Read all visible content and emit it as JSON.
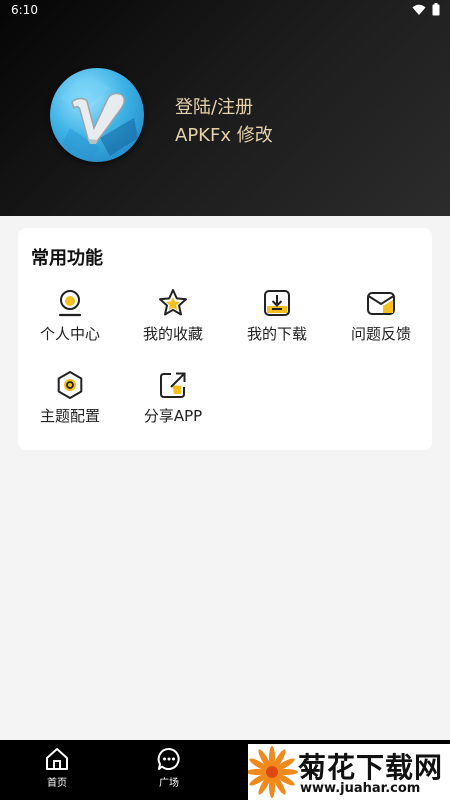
{
  "status_bar": {
    "time": "6:10"
  },
  "profile": {
    "login_label": "登陆/注册",
    "subtitle": "APKFx 修改",
    "avatar_letter": "V"
  },
  "features": {
    "title": "常用功能",
    "items": [
      {
        "label": "个人中心",
        "icon": "user-icon"
      },
      {
        "label": "我的收藏",
        "icon": "star-icon"
      },
      {
        "label": "我的下载",
        "icon": "download-icon"
      },
      {
        "label": "问题反馈",
        "icon": "mail-icon"
      },
      {
        "label": "主题配置",
        "icon": "theme-icon"
      },
      {
        "label": "分享APP",
        "icon": "share-icon"
      }
    ]
  },
  "bottom_nav": {
    "items": [
      {
        "label": "首页",
        "icon": "home-icon"
      },
      {
        "label": "广场",
        "icon": "chat-icon"
      }
    ]
  },
  "watermark": {
    "title": "菊花下载网",
    "url": "www.juahar.com"
  },
  "colors": {
    "accent": "#f5bf1f",
    "gold_text": "#e6d3ad",
    "header_bg": "#111111"
  }
}
